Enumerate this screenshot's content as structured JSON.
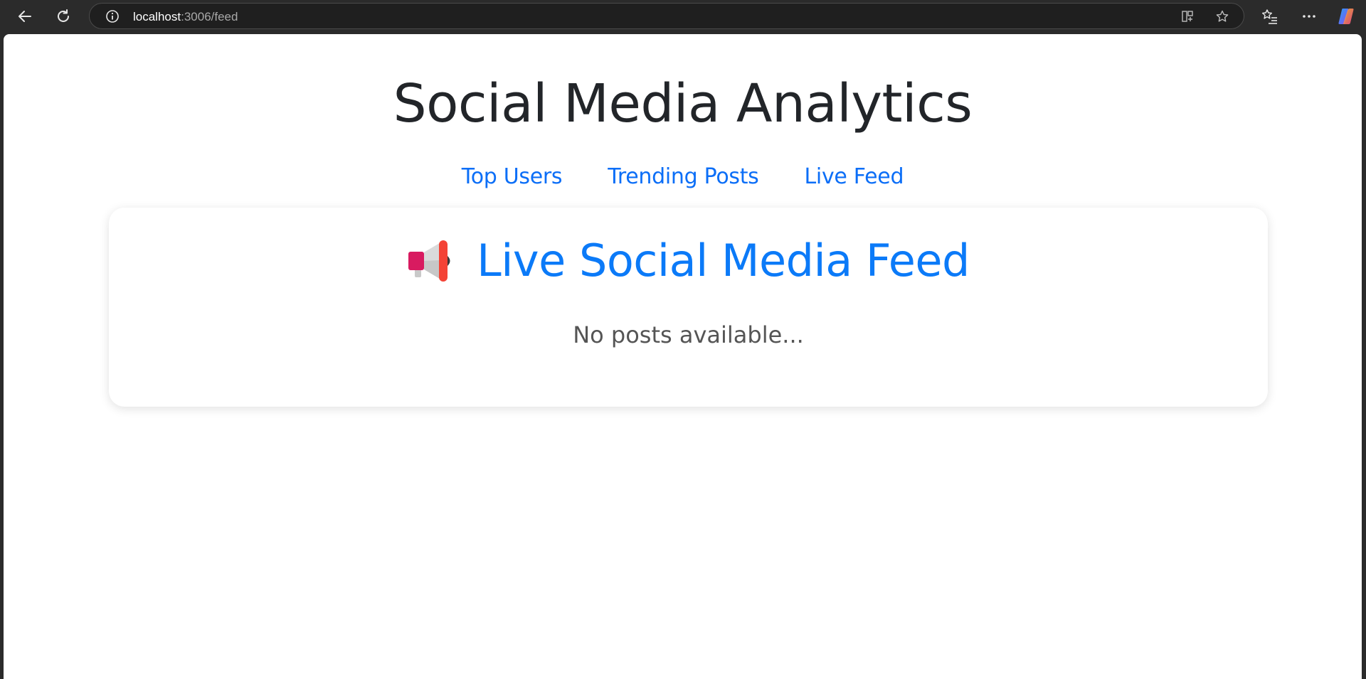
{
  "browser": {
    "url_host": "localhost",
    "url_path": ":3006/feed"
  },
  "app": {
    "title": "Social Media Analytics"
  },
  "nav": {
    "links": [
      {
        "label": "Top Users"
      },
      {
        "label": "Trending Posts"
      },
      {
        "label": "Live Feed"
      }
    ]
  },
  "feed": {
    "icon": "megaphone-icon",
    "title": "Live Social Media Feed",
    "empty_message": "No posts available..."
  },
  "colors": {
    "link": "#0b6ef7",
    "heading_accent": "#0b7af8",
    "title_text": "#222529",
    "muted_text": "#555555"
  }
}
